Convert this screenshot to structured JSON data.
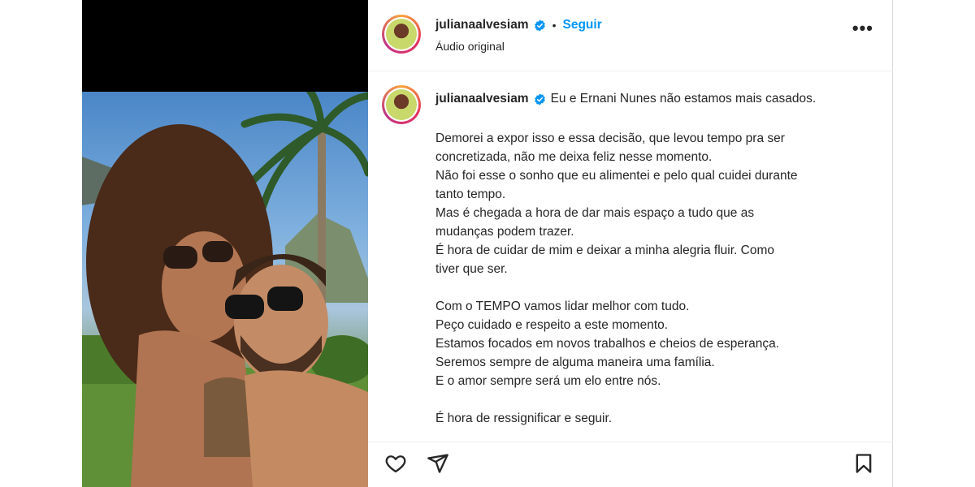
{
  "post": {
    "author": {
      "username": "julianaalvesiam",
      "verified": true
    },
    "header": {
      "separator": "•",
      "follow_label": "Seguir",
      "audio_label": "Áudio original",
      "more_label": "•••"
    },
    "caption": {
      "first_line": "Eu e Ernani Nunes não estamos mais casados.",
      "paragraphs": [
        [
          "Demorei a expor isso e essa decisão, que levou tempo pra ser",
          "concretizada, não me deixa feliz nesse momento.",
          "Não foi esse o sonho que eu alimentei e pelo qual cuidei durante",
          "tanto tempo.",
          "Mas é chegada a hora de dar mais espaço a tudo que as",
          "mudanças podem trazer.",
          "É hora de cuidar de mim e deixar a minha alegria fluir. Como",
          "tiver que ser."
        ],
        [
          "Com o TEMPO vamos lidar melhor com tudo.",
          "Peço cuidado e respeito a este momento.",
          "Estamos focados em novos trabalhos e cheios de esperança.",
          "Seremos sempre de alguma maneira uma família.",
          "E o amor sempre será um elo entre nós."
        ],
        [
          "É hora de ressignificar e seguir."
        ]
      ]
    }
  },
  "colors": {
    "follow": "#0095f6",
    "verified": "#0095f6",
    "text": "#262626"
  },
  "icons": [
    "verified-badge-icon",
    "more-options-icon",
    "heart-icon",
    "share-icon",
    "bookmark-icon"
  ]
}
